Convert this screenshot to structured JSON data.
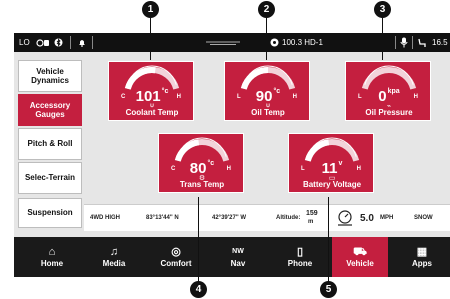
{
  "callouts": [
    "1",
    "2",
    "3",
    "4",
    "5"
  ],
  "status": {
    "lo": "LO",
    "icon_fan_seat": "fan-seat-icon",
    "icon_bluetooth": "bluetooth-icon",
    "icon_bell": "bell-icon",
    "radio": "100.3 HD-1",
    "icon_mic": "mic-icon",
    "right_value": "16.5"
  },
  "sidebar": {
    "items": [
      {
        "label": "Vehicle Dynamics",
        "active": false
      },
      {
        "label": "Accessory Gauges",
        "active": true
      },
      {
        "label": "Pitch & Roll",
        "active": false
      },
      {
        "label": "Selec-Terrain",
        "active": false
      },
      {
        "label": "Suspension",
        "active": false
      }
    ]
  },
  "gauges": [
    {
      "name": "coolant",
      "value": "101",
      "unit": "°c",
      "label": "Coolant Temp",
      "low": "C",
      "high": "H",
      "level": 0.55,
      "icon": "coolant-temp-icon"
    },
    {
      "name": "oil-temp",
      "value": "90",
      "unit": "°c",
      "label": "Oil Temp",
      "low": "L",
      "high": "H",
      "level": 0.5,
      "icon": "oil-temp-icon"
    },
    {
      "name": "oil-pressure",
      "value": "0",
      "unit": "kpa",
      "label": "Oil Pressure",
      "low": "L",
      "high": "H",
      "level": 0.0,
      "icon": "oil-pressure-icon"
    },
    {
      "name": "trans-temp",
      "value": "80",
      "unit": "°c",
      "label": "Trans Temp",
      "low": "C",
      "high": "H",
      "level": 0.45,
      "icon": "trans-temp-icon"
    },
    {
      "name": "battery",
      "value": "11",
      "unit": "v",
      "label": "Battery Voltage",
      "low": "L",
      "high": "H",
      "level": 0.45,
      "icon": "battery-icon"
    }
  ],
  "info": {
    "drive_mode": "4WD HIGH",
    "latitude": "83°13'44\" N",
    "longitude": "42°39'27\" W",
    "altitude_label": "Altitude:",
    "altitude_value": "159",
    "altitude_unit": "m",
    "speed": "5.0",
    "speed_unit": "MPH",
    "terrain": "SNOW"
  },
  "nav": [
    {
      "label": "Home",
      "icon": "home-icon",
      "glyph": "⌂",
      "active": false
    },
    {
      "label": "Media",
      "icon": "music-note-icon",
      "glyph": "♫",
      "active": false
    },
    {
      "label": "Comfort",
      "icon": "comfort-icon",
      "glyph": "◎",
      "active": false
    },
    {
      "label": "Nav",
      "icon": "compass-icon",
      "glyph": "NW",
      "active": false
    },
    {
      "label": "Phone",
      "icon": "phone-icon",
      "glyph": "▯",
      "active": false
    },
    {
      "label": "Vehicle",
      "icon": "car-icon",
      "glyph": "⛟",
      "active": true
    },
    {
      "label": "Apps",
      "icon": "apps-grid-icon",
      "glyph": "▦",
      "active": false
    }
  ],
  "colors": {
    "accent": "#c41f3f",
    "bar": "#111111",
    "nav_bg": "#1a1a1a",
    "screen_bg": "#e6e6e6"
  }
}
